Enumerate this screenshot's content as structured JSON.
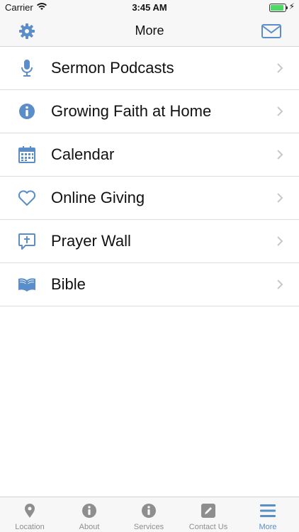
{
  "status_bar": {
    "carrier": "Carrier",
    "time": "3:45 AM",
    "battery_level": 0.9,
    "battery_color": "#4cd964"
  },
  "nav": {
    "title": "More",
    "left_icon": "gear-icon",
    "right_icon": "mail-icon"
  },
  "colors": {
    "accent": "#5b8ec8",
    "tab_inactive": "#8e8e8e"
  },
  "menu": {
    "items": [
      {
        "label": "Sermon Podcasts",
        "icon": "microphone-icon"
      },
      {
        "label": "Growing Faith at Home",
        "icon": "info-icon"
      },
      {
        "label": "Calendar",
        "icon": "calendar-icon"
      },
      {
        "label": "Online Giving",
        "icon": "heart-icon"
      },
      {
        "label": "Prayer Wall",
        "icon": "cross-speech-bubble-icon"
      },
      {
        "label": "Bible",
        "icon": "open-book-icon"
      }
    ]
  },
  "tabs": {
    "items": [
      {
        "label": "Location",
        "icon": "map-pin-icon"
      },
      {
        "label": "About",
        "icon": "info-icon"
      },
      {
        "label": "Services",
        "icon": "info-icon"
      },
      {
        "label": "Contact Us",
        "icon": "pencil-icon"
      },
      {
        "label": "More",
        "icon": "hamburger-menu-icon"
      }
    ],
    "active": "More"
  }
}
